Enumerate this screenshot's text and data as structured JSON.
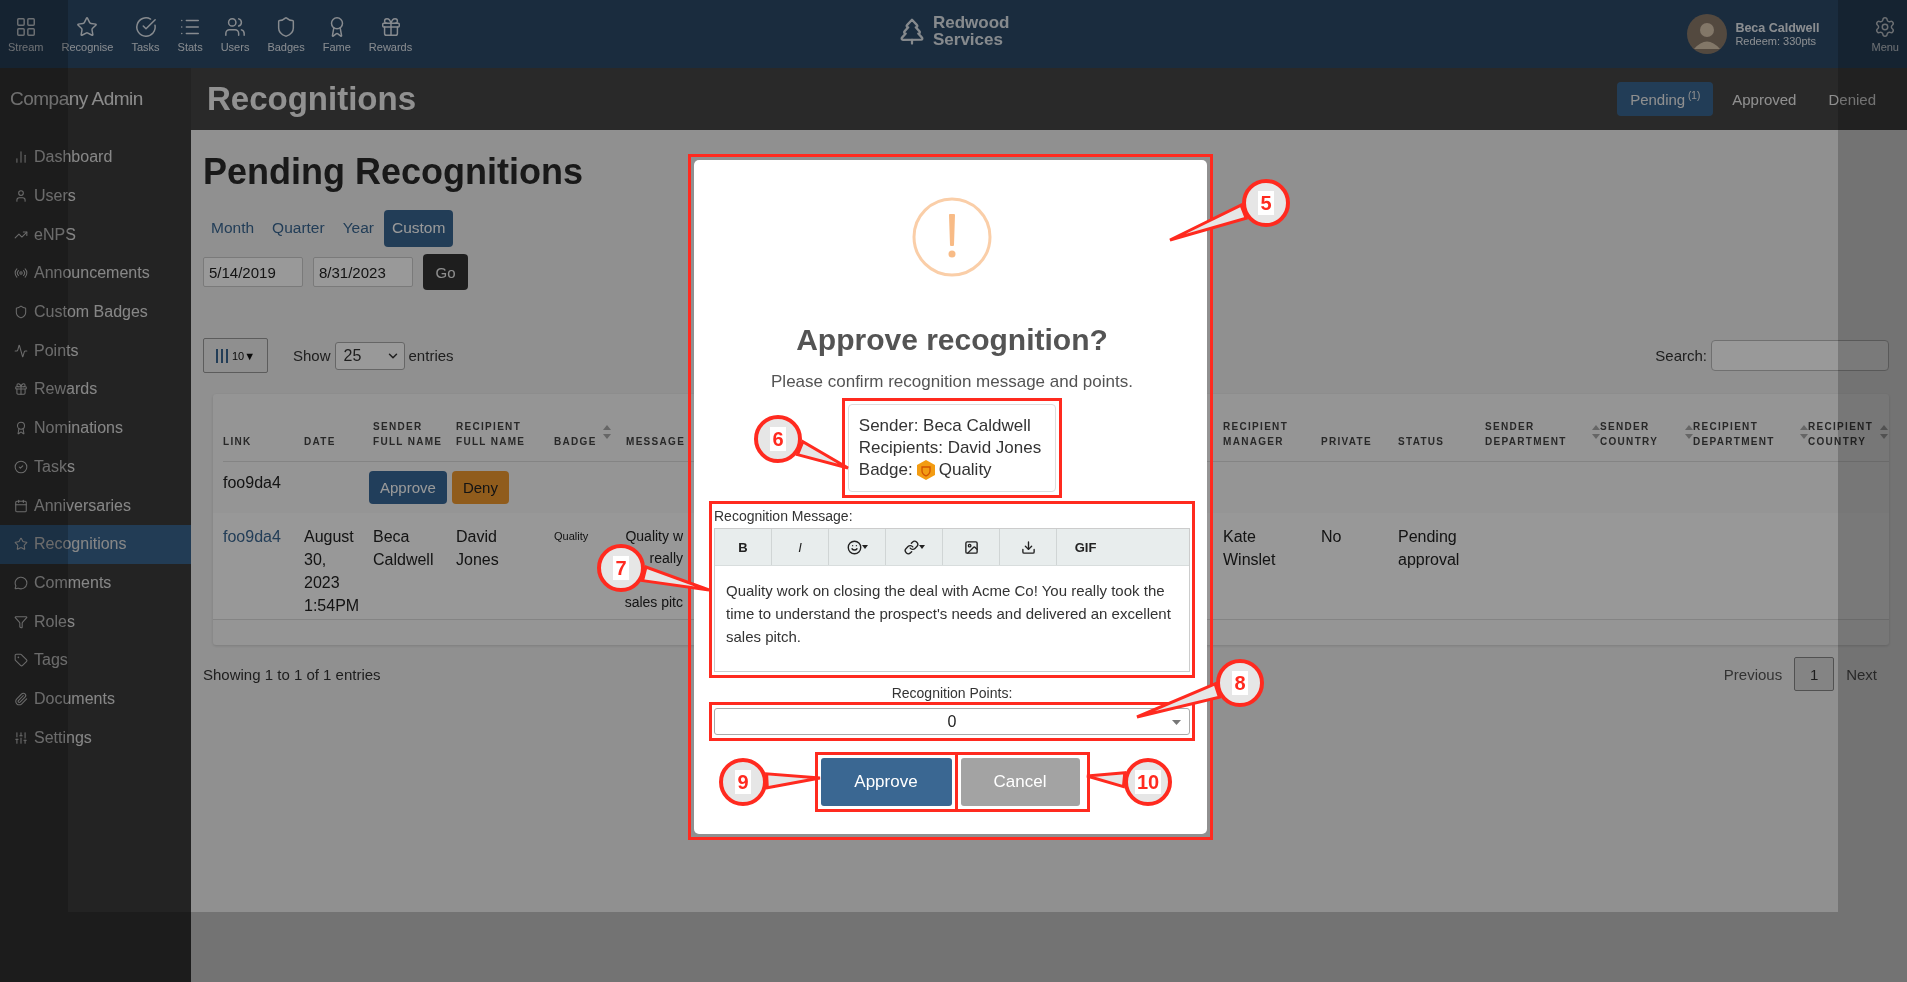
{
  "top_nav": {
    "items": [
      {
        "label": "Stream"
      },
      {
        "label": "Recognise"
      },
      {
        "label": "Tasks"
      },
      {
        "label": "Stats"
      },
      {
        "label": "Users"
      },
      {
        "label": "Badges"
      },
      {
        "label": "Fame"
      },
      {
        "label": "Rewards"
      }
    ],
    "logo_lines": [
      "Redwood",
      "Services"
    ],
    "user": {
      "name": "Beca Caldwell",
      "points": "Redeem: 330pts"
    },
    "menu_label": "Menu"
  },
  "sidebar": {
    "title": "Company Admin",
    "items": [
      {
        "label": "Dashboard",
        "selected": false
      },
      {
        "label": "Users",
        "selected": false
      },
      {
        "label": "eNPS",
        "selected": false
      },
      {
        "label": "Announcements",
        "selected": false
      },
      {
        "label": "Custom Badges",
        "selected": false
      },
      {
        "label": "Points",
        "selected": false
      },
      {
        "label": "Rewards",
        "selected": false
      },
      {
        "label": "Nominations",
        "selected": false
      },
      {
        "label": "Tasks",
        "selected": false
      },
      {
        "label": "Anniversaries",
        "selected": false
      },
      {
        "label": "Recognitions",
        "selected": true
      },
      {
        "label": "Comments",
        "selected": false
      },
      {
        "label": "Roles",
        "selected": false
      },
      {
        "label": "Tags",
        "selected": false
      },
      {
        "label": "Documents",
        "selected": false
      },
      {
        "label": "Settings",
        "selected": false
      }
    ]
  },
  "header": {
    "title": "Recognitions",
    "tabs": [
      {
        "label": "Pending",
        "count": "(1)",
        "selected": true
      },
      {
        "label": "Approved",
        "selected": false
      },
      {
        "label": "Denied",
        "selected": false
      }
    ]
  },
  "page": {
    "heading": "Pending Recognitions",
    "periods": [
      {
        "label": "Month",
        "selected": false
      },
      {
        "label": "Quarter",
        "selected": false
      },
      {
        "label": "Year",
        "selected": false
      },
      {
        "label": "Custom",
        "selected": true
      }
    ],
    "date_from": "5/14/2019",
    "date_to": "8/31/2023",
    "go": "Go"
  },
  "table_controls": {
    "columns_button": "10▼",
    "show_label": "Show",
    "page_size": "25",
    "entries_label": "entries",
    "search_label": "Search:"
  },
  "table": {
    "columns": [
      {
        "label": "LINK",
        "sortable": false
      },
      {
        "label": "DATE",
        "sortable": false
      },
      {
        "label": "SENDER FULL NAME",
        "sortable": false
      },
      {
        "label": "RECIPIENT FULL NAME",
        "sortable": false
      },
      {
        "label": "BADGE",
        "sortable": true
      },
      {
        "label": "MESSAGE"
      },
      {
        "label": "RECIPIENT MANAGER",
        "sortable": false
      },
      {
        "label": "PRIVATE",
        "sortable": false
      },
      {
        "label": "STATUS",
        "sortable": false
      },
      {
        "label": "SENDER DEPARTMENT",
        "sortable": true
      },
      {
        "label": "SENDER COUNTRY",
        "sortable": true
      },
      {
        "label": "RECIPIENT DEPARTMENT",
        "sortable": true
      },
      {
        "label": "RECIPIENT COUNTRY",
        "sortable": true
      }
    ],
    "pending_row": {
      "link": "foo9da4",
      "approve": "Approve",
      "deny": "Deny"
    },
    "rows": [
      {
        "link": "foo9da4",
        "date": "August 30, 2023 1:54PM",
        "sender": "Beca Caldwell",
        "recipient": "David Jones",
        "badge": "Quality",
        "message_lines": [
          "Quality w",
          "really",
          "sales pitc"
        ],
        "recipient_manager": "Kate Winslet",
        "private": "No",
        "status": "Pending approval"
      }
    ]
  },
  "footer": {
    "info": "Showing 1 to 1 of 1 entries",
    "previous": "Previous",
    "pages": [
      {
        "label": "1",
        "selected": true
      }
    ],
    "next": "Next"
  },
  "modal": {
    "title": "Approve recognition?",
    "subtitle": "Please confirm recognition message and points.",
    "detail_lines": [
      "Sender: Beca Caldwell",
      "Recipients: David Jones"
    ],
    "badge": {
      "label": "Badge:",
      "name": "Quality"
    },
    "message_label": "Recognition Message:",
    "toolbar": [
      {
        "kind": "bold",
        "label": "B"
      },
      {
        "kind": "italic",
        "label": "I"
      },
      {
        "kind": "emoji"
      },
      {
        "kind": "link"
      },
      {
        "kind": "image"
      },
      {
        "kind": "download"
      },
      {
        "kind": "gif",
        "label": "GIF"
      }
    ],
    "message": "Quality work on closing the deal with Acme Co! You really took the time to understand the prospect's needs and delivered an excellent sales pitch.",
    "points_label": "Recognition Points:",
    "points": "0",
    "approve": "Approve",
    "cancel": "Cancel"
  },
  "annotations": [
    {
      "label": "5"
    },
    {
      "label": "6"
    },
    {
      "label": "7"
    },
    {
      "label": "8"
    },
    {
      "label": "9"
    },
    {
      "label": "10"
    }
  ]
}
